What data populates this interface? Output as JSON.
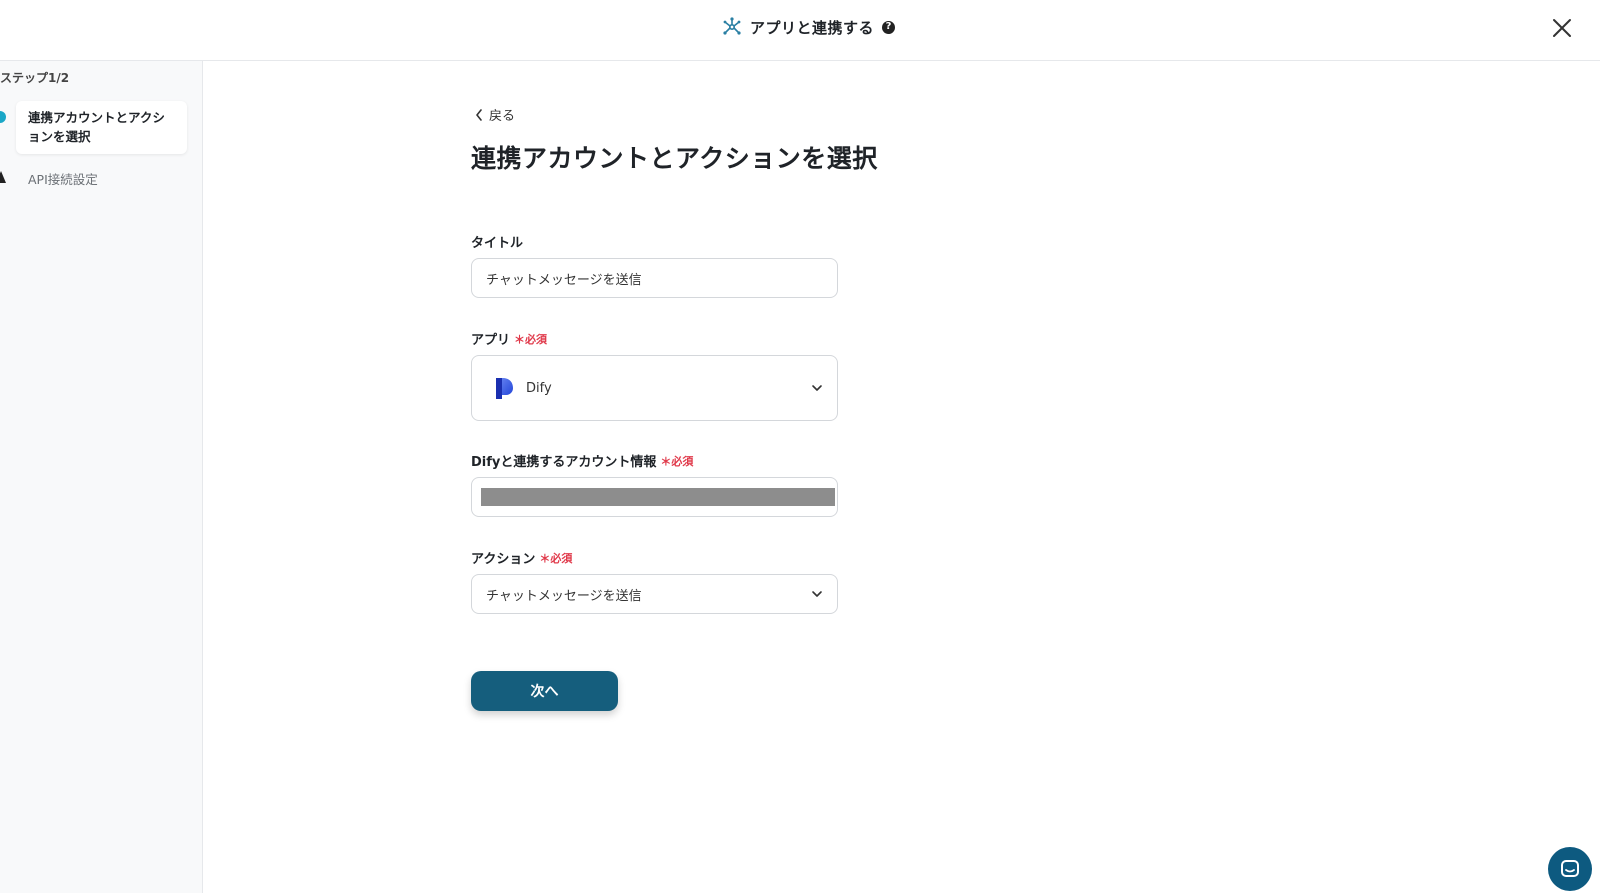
{
  "header": {
    "title": "アプリと連携する",
    "help_glyph": "?",
    "icon": "network-icon",
    "close_icon": "close-icon"
  },
  "sidebar": {
    "step_label": "ステップ1/2",
    "steps": [
      {
        "label_line1": "連携アカウントとアクシ",
        "label_line2": "ョンを選択",
        "active": true
      },
      {
        "label": "API接続設定",
        "active": false
      }
    ]
  },
  "main": {
    "back_label": "戻る",
    "title": "連携アカウントとアクションを選択",
    "fields": {
      "title": {
        "label": "タイトル",
        "value": "チャットメッセージを送信"
      },
      "app": {
        "label": "アプリ",
        "required": "＊必須",
        "value": "Dify",
        "icon": "dify-logo-icon"
      },
      "account": {
        "label": "Difyと連携するアカウント情報",
        "required": "＊必須"
      },
      "action": {
        "label": "アクション",
        "required": "＊必須",
        "value": "チャットメッセージを送信"
      }
    },
    "next_label": "次へ"
  },
  "colors": {
    "primary": "#155e7d",
    "required": "#e0394a",
    "accent": "#1aa7c7"
  }
}
